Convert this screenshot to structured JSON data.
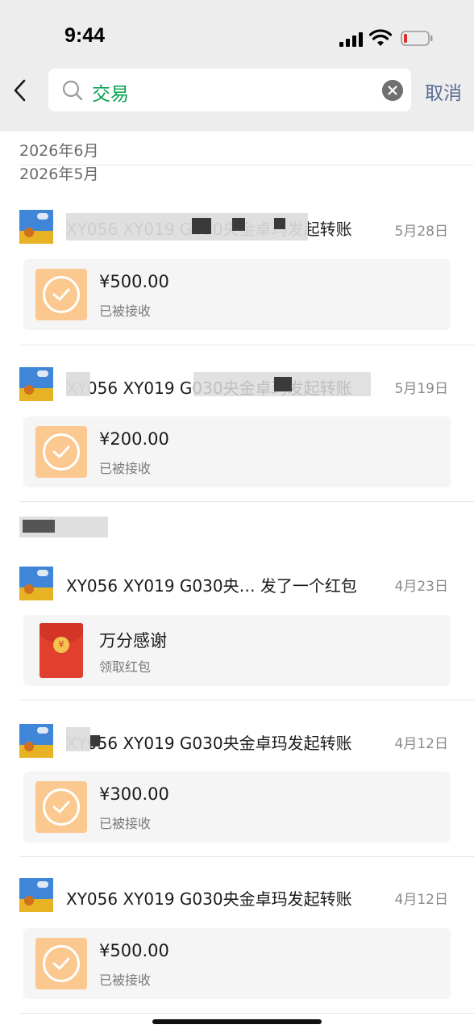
{
  "status_bar": {
    "time": "9:44"
  },
  "search": {
    "query": "交易",
    "cancel_label": "取消"
  },
  "months": [
    "2026年6月",
    "2026年5月"
  ],
  "items": [
    {
      "title": "XY056 XY019 G030央金卓玛发起转账",
      "date": "5月28日",
      "amount": "¥500.00",
      "status": "已被接收"
    },
    {
      "title": "XY056 XY019 G030央金卓玛发起转账",
      "date": "5月19日",
      "amount": "¥200.00",
      "status": "已被接收"
    },
    {
      "title": "XY056 XY019 G030央…  发了一个红包",
      "date": "4月23日",
      "amount": "万分感谢",
      "status": "领取红包"
    },
    {
      "title": "XY056 XY019 G030央金卓玛发起转账",
      "date": "4月12日",
      "amount": "¥300.00",
      "status": "已被接收"
    },
    {
      "title": "XY056 XY019 G030央金卓玛发起转账",
      "date": "4月12日",
      "amount": "¥500.00",
      "status": "已被接收"
    }
  ],
  "colors": {
    "accent_green": "#07a14f",
    "link_blue": "#576b95",
    "transfer_orange": "#fbc88f",
    "redpacket_red": "#e2402f"
  },
  "icons": [
    "back-arrow-icon",
    "search-icon",
    "clear-icon",
    "transfer-check-icon",
    "red-packet-icon",
    "signal-icon",
    "wifi-icon",
    "battery-icon"
  ]
}
